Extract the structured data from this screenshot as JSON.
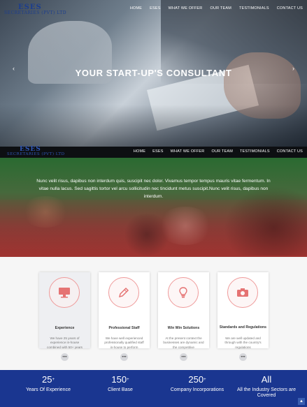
{
  "brand": {
    "line1": "ESES",
    "line2": "SECRETARIES (PVT) LTD"
  },
  "nav": [
    "HOME",
    "ESES",
    "WHAT WE OFFER",
    "OUR TEAM",
    "TESTIMONIALS",
    "CONTACT US"
  ],
  "hero": {
    "title": "YOUR START-UP'S CONSULTANT",
    "prev_icon": "‹",
    "next_icon": "›"
  },
  "band": {
    "text": "Nunc velit risus, dapibus non interdum quis, suscipit nec dolor. Vivamus tempor tempus mauris vitae fermentum. In vitae nulla lacus. Sed sagittis tortor vel arcu sollicitudin nec tincidunt metus suscipit.Nunc velit risus, dapibus non interdum."
  },
  "features": [
    {
      "icon": "monitor-icon",
      "title": "Experience",
      "desc": "We have 25 years of experience in-house combined with 50+ years"
    },
    {
      "icon": "pencil-icon",
      "title": "Professional Staff",
      "desc": "We have well experienced professionally qualified staff in-house to perform"
    },
    {
      "icon": "lightbulb-icon",
      "title": "Win Win Solutions",
      "desc": "At the present context the businesses are dynamic and the competitive"
    },
    {
      "icon": "camera-icon",
      "title": "Standards and Regulations",
      "desc": "We are well updated and through with the country's regulations"
    }
  ],
  "more_label": "•••",
  "stats": [
    {
      "num": "25",
      "plus": "+",
      "label": "Years Of Experience"
    },
    {
      "num": "150",
      "plus": "+",
      "label": "Client Base"
    },
    {
      "num": "250",
      "plus": "+",
      "label": "Company Incorporations"
    },
    {
      "num": "All",
      "plus": "",
      "label": "All the Industry Sectors are Covered"
    }
  ],
  "colors": {
    "brand_blue": "#1a3690",
    "accent_red": "#ef9a9a"
  }
}
